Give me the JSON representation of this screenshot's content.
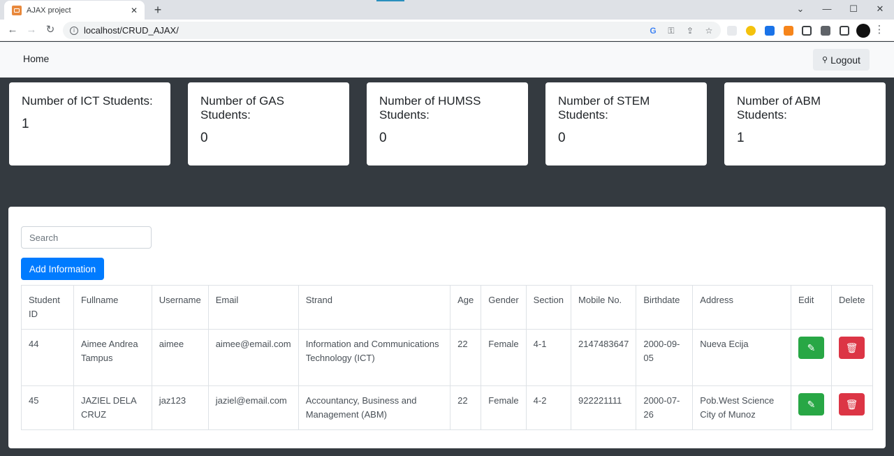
{
  "browser": {
    "tab_title": "AJAX project",
    "tab_close": "✕",
    "new_tab": "+",
    "url": "localhost/CRUD_AJAX/",
    "window_controls": {
      "dropdown": "⌄",
      "minimize": "—",
      "maximize": "☐",
      "close": "✕"
    },
    "nav": {
      "back": "←",
      "forward": "→",
      "reload": "↻"
    },
    "omnibox_icons": {
      "google": "G",
      "key": "⚿",
      "share": "⇪",
      "star": "☆"
    },
    "more_menu": "⋮"
  },
  "navbar": {
    "home_label": "Home",
    "logout_label": "Logout",
    "logout_icon": "person-icon"
  },
  "cards": [
    {
      "title": "Number of ICT Students:",
      "value": "1"
    },
    {
      "title": "Number of GAS Students:",
      "value": "0"
    },
    {
      "title": "Number of HUMSS Students:",
      "value": "0"
    },
    {
      "title": "Number of STEM Students:",
      "value": "0"
    },
    {
      "title": "Number of ABM Students:",
      "value": "1"
    }
  ],
  "main": {
    "search_placeholder": "Search",
    "add_label": "Add Information",
    "columns": [
      "Student ID",
      "Fullname",
      "Username",
      "Email",
      "Strand",
      "Age",
      "Gender",
      "Section",
      "Mobile No.",
      "Birthdate",
      "Address",
      "Edit",
      "Delete"
    ],
    "rows": [
      {
        "id": "44",
        "fullname": "Aimee Andrea Tampus",
        "username": "aimee",
        "email": "aimee@email.com",
        "strand": "Information and Communications Technology (ICT)",
        "age": "22",
        "gender": "Female",
        "section": "4-1",
        "mobile": "2147483647",
        "birthdate": "2000-09-05",
        "address": "Nueva Ecija"
      },
      {
        "id": "45",
        "fullname": "JAZIEL DELA CRUZ",
        "username": "jaz123",
        "email": "jaziel@email.com",
        "strand": "Accountancy, Business and Management (ABM)",
        "age": "22",
        "gender": "Female",
        "section": "4-2",
        "mobile": "922221111",
        "birthdate": "2000-07-26",
        "address": "Pob.West Science City of Munoz"
      }
    ]
  },
  "colors": {
    "primary": "#007bff",
    "success": "#28a745",
    "danger": "#dc3545",
    "dark": "#343a40"
  }
}
